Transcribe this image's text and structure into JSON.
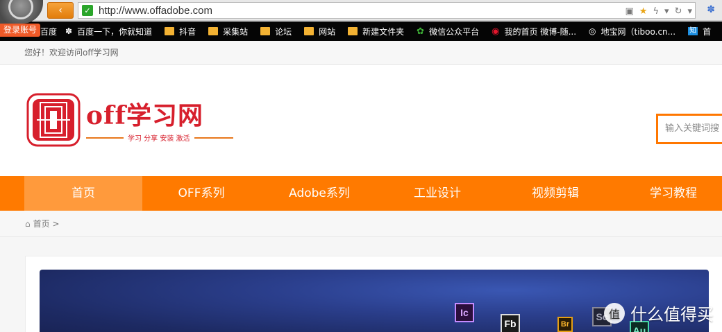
{
  "browser": {
    "url": "http://www.offadobe.com",
    "back_label": "‹",
    "login_tag": "登录账号",
    "bookmarks": [
      {
        "label": "百度",
        "icon": "paw-icon"
      },
      {
        "label": "百度一下，你就知道",
        "icon": "paw-icon"
      },
      {
        "label": "抖音",
        "icon": "folder-icon"
      },
      {
        "label": "采集站",
        "icon": "folder-icon"
      },
      {
        "label": "论坛",
        "icon": "folder-icon"
      },
      {
        "label": "网站",
        "icon": "folder-icon"
      },
      {
        "label": "新建文件夹",
        "icon": "folder-icon"
      },
      {
        "label": "微信公众平台",
        "icon": "wechat-icon"
      },
      {
        "label": "我的首页 微博-随...",
        "icon": "weibo-icon"
      },
      {
        "label": "地宝网（tiboo.cn...",
        "icon": "tiboo-icon"
      },
      {
        "label": "首",
        "icon": "zhihu-icon"
      }
    ]
  },
  "site": {
    "welcome": "您好！欢迎访问off学习网",
    "logo_title": "off学习网",
    "logo_subtitle": "学习 分享 安装 激活",
    "search_placeholder": "输入关键词搜",
    "nav": [
      "首页",
      "OFF系列",
      "Adobe系列",
      "工业设计",
      "视频剪辑",
      "学习教程"
    ],
    "active_nav": "首页",
    "breadcrumb": "首页 >",
    "banner_apps": [
      "Ic",
      "Fb",
      "Br",
      "Sc",
      "Au"
    ]
  },
  "watermark": {
    "text": "什么值得买",
    "badge": "值"
  },
  "colors": {
    "nav_orange": "#ff7a00",
    "logo_red": "#d71f2c"
  }
}
